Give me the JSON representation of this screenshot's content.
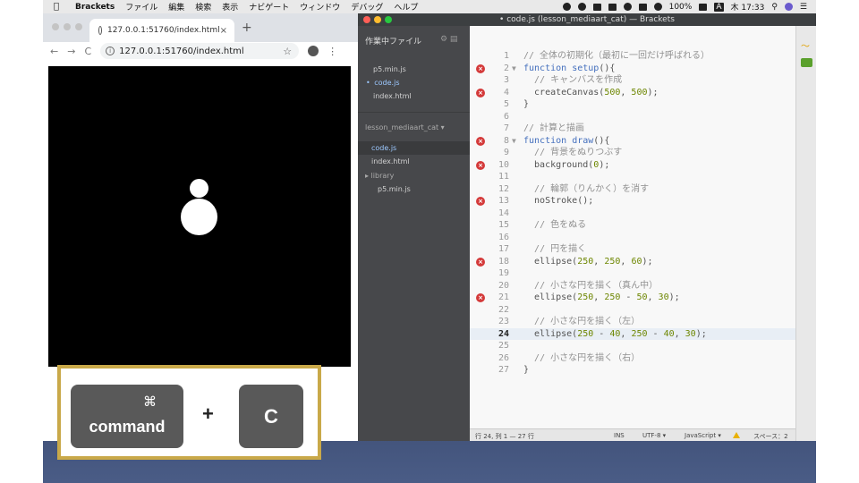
{
  "menubar": {
    "app_name": "Brackets",
    "items": [
      "ファイル",
      "編集",
      "検索",
      "表示",
      "ナビゲート",
      "ウィンドウ",
      "デバッグ",
      "ヘルプ"
    ],
    "battery": "100%",
    "input_mode": "A",
    "clock": "木 17:33"
  },
  "browser": {
    "tab_title": "127.0.0.1:51760/index.html",
    "tab_close": "×",
    "new_tab": "+",
    "url": "127.0.0.1:51760/index.html",
    "back": "←",
    "forward": "→",
    "reload": "C",
    "star": "☆",
    "menu": "⋮"
  },
  "shortcut": {
    "command_symbol": "⌘",
    "command_label": "command",
    "plus": "+",
    "key": "C",
    "frame_color": "#c9a949"
  },
  "editor": {
    "window_title": "• code.js (lesson_mediaart_cat) — Brackets",
    "working_files_label": "作業中ファイル",
    "working_files": [
      {
        "name": "p5.min.js",
        "modified": false
      },
      {
        "name": "code.js",
        "modified": true
      },
      {
        "name": "index.html",
        "modified": false
      }
    ],
    "project_name": "lesson_mediaart_cat ▾",
    "project_tree": [
      {
        "name": "code.js",
        "selected": true,
        "indent": 0
      },
      {
        "name": "index.html",
        "selected": false,
        "indent": 0
      },
      {
        "name": "▸ library",
        "selected": false,
        "indent": 0
      },
      {
        "name": "p5.min.js",
        "selected": false,
        "indent": 1
      }
    ],
    "lines": [
      {
        "n": "1",
        "err": false,
        "fold": "",
        "tokens": [
          [
            "com",
            "// 全体の初期化（最初に一回だけ呼ばれる）"
          ]
        ]
      },
      {
        "n": "2",
        "err": true,
        "fold": "▼",
        "tokens": [
          [
            "kw",
            "function"
          ],
          [
            "cm",
            " "
          ],
          [
            "fn",
            "setup"
          ],
          [
            "cm",
            "(){"
          ]
        ]
      },
      {
        "n": "3",
        "err": false,
        "fold": "",
        "tokens": [
          [
            "cm",
            "  "
          ],
          [
            "com",
            "// キャンバスを作成"
          ]
        ]
      },
      {
        "n": "4",
        "err": true,
        "fold": "",
        "tokens": [
          [
            "cm",
            "  createCanvas("
          ],
          [
            "num",
            "500"
          ],
          [
            "cm",
            ", "
          ],
          [
            "num",
            "500"
          ],
          [
            "cm",
            ");"
          ]
        ]
      },
      {
        "n": "5",
        "err": false,
        "fold": "",
        "tokens": [
          [
            "cm",
            "}"
          ]
        ]
      },
      {
        "n": "6",
        "err": false,
        "fold": "",
        "tokens": []
      },
      {
        "n": "7",
        "err": false,
        "fold": "",
        "tokens": [
          [
            "com",
            "// 計算と描画"
          ]
        ]
      },
      {
        "n": "8",
        "err": true,
        "fold": "▼",
        "tokens": [
          [
            "kw",
            "function"
          ],
          [
            "cm",
            " "
          ],
          [
            "fn",
            "draw"
          ],
          [
            "cm",
            "(){"
          ]
        ]
      },
      {
        "n": "9",
        "err": false,
        "fold": "",
        "tokens": [
          [
            "cm",
            "  "
          ],
          [
            "com",
            "// 背景をぬりつぶす"
          ]
        ]
      },
      {
        "n": "10",
        "err": true,
        "fold": "",
        "tokens": [
          [
            "cm",
            "  background("
          ],
          [
            "num",
            "0"
          ],
          [
            "cm",
            ");"
          ]
        ]
      },
      {
        "n": "11",
        "err": false,
        "fold": "",
        "tokens": []
      },
      {
        "n": "12",
        "err": false,
        "fold": "",
        "tokens": [
          [
            "cm",
            "  "
          ],
          [
            "com",
            "// 輪郭（りんかく）を消す"
          ]
        ]
      },
      {
        "n": "13",
        "err": true,
        "fold": "",
        "tokens": [
          [
            "cm",
            "  noStroke();"
          ]
        ]
      },
      {
        "n": "14",
        "err": false,
        "fold": "",
        "tokens": []
      },
      {
        "n": "15",
        "err": false,
        "fold": "",
        "tokens": [
          [
            "cm",
            "  "
          ],
          [
            "com",
            "// 色をぬる"
          ]
        ]
      },
      {
        "n": "16",
        "err": false,
        "fold": "",
        "tokens": []
      },
      {
        "n": "17",
        "err": false,
        "fold": "",
        "tokens": [
          [
            "cm",
            "  "
          ],
          [
            "com",
            "// 円を描く"
          ]
        ]
      },
      {
        "n": "18",
        "err": true,
        "fold": "",
        "tokens": [
          [
            "cm",
            "  ellipse("
          ],
          [
            "num",
            "250"
          ],
          [
            "cm",
            ", "
          ],
          [
            "num",
            "250"
          ],
          [
            "cm",
            ", "
          ],
          [
            "num",
            "60"
          ],
          [
            "cm",
            ");"
          ]
        ]
      },
      {
        "n": "19",
        "err": false,
        "fold": "",
        "tokens": []
      },
      {
        "n": "20",
        "err": false,
        "fold": "",
        "tokens": [
          [
            "cm",
            "  "
          ],
          [
            "com",
            "// 小さな円を描く（真ん中）"
          ]
        ]
      },
      {
        "n": "21",
        "err": true,
        "fold": "",
        "tokens": [
          [
            "cm",
            "  ellipse("
          ],
          [
            "num",
            "250"
          ],
          [
            "cm",
            ", "
          ],
          [
            "num",
            "250"
          ],
          [
            "cm",
            " - "
          ],
          [
            "num",
            "50"
          ],
          [
            "cm",
            ", "
          ],
          [
            "num",
            "30"
          ],
          [
            "cm",
            ");"
          ]
        ]
      },
      {
        "n": "22",
        "err": false,
        "fold": "",
        "tokens": []
      },
      {
        "n": "23",
        "err": false,
        "fold": "",
        "tokens": [
          [
            "cm",
            "  "
          ],
          [
            "com",
            "// 小さな円を描く（左）"
          ]
        ]
      },
      {
        "n": "24",
        "err": false,
        "fold": "",
        "cur": true,
        "tokens": [
          [
            "cm",
            "  ellipse("
          ],
          [
            "num",
            "250"
          ],
          [
            "cm",
            " - "
          ],
          [
            "num",
            "40"
          ],
          [
            "cm",
            ", "
          ],
          [
            "num",
            "250"
          ],
          [
            "cm",
            " - "
          ],
          [
            "num",
            "40"
          ],
          [
            "cm",
            ", "
          ],
          [
            "num",
            "30"
          ],
          [
            "cm",
            ");"
          ]
        ]
      },
      {
        "n": "25",
        "err": false,
        "fold": "",
        "tokens": []
      },
      {
        "n": "26",
        "err": false,
        "fold": "",
        "tokens": [
          [
            "cm",
            "  "
          ],
          [
            "com",
            "// 小さな円を描く（右）"
          ]
        ]
      },
      {
        "n": "27",
        "err": false,
        "fold": "",
        "tokens": [
          [
            "cm",
            "}"
          ]
        ]
      }
    ],
    "status": {
      "position": "行 24, 列 1 — 27 行",
      "ins": "INS",
      "encoding": "UTF-8 ▾",
      "language": "JavaScript ▾",
      "spaces": "スペース：2"
    }
  }
}
